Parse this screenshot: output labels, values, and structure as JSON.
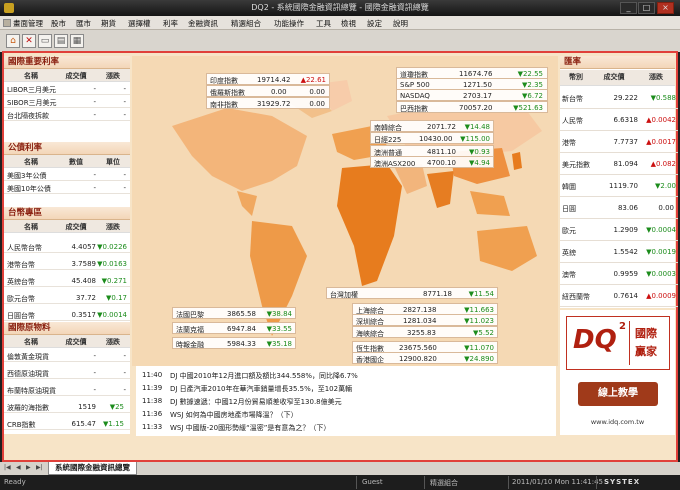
{
  "window": {
    "title": "DQ2 - 系統國際金融資訊總覽 - 國際金融資訊總覽",
    "min": "_",
    "max": "□",
    "close": "×"
  },
  "menu": [
    "畫面管理",
    "股市",
    "匯市",
    "期貨",
    "選擇權",
    "利率",
    "金融資訊",
    "精選組合",
    "功能操作",
    "工具",
    "檢視",
    "設定",
    "說明"
  ],
  "colors": {
    "up": "#1c8c1c",
    "down": "#cc1010",
    "accent": "#e0403a",
    "header": "#8a2010"
  },
  "left": {
    "sec1": {
      "title": "國際重要利率",
      "cols": [
        "名稱",
        "成交價",
        "漲跌"
      ],
      "rows": [
        {
          "name": "LIBOR三月美元",
          "price": "-",
          "chg": "-"
        },
        {
          "name": "SIBOR三月美元",
          "price": "-",
          "chg": "-"
        },
        {
          "name": "台北隔夜拆款",
          "price": "-",
          "chg": "-"
        }
      ]
    },
    "sec2": {
      "title": "公債利率",
      "cols": [
        "名稱",
        "數值",
        "單位"
      ],
      "rows": [
        {
          "name": "美國3年公債",
          "price": "-",
          "chg": "-"
        },
        {
          "name": "美國10年公債",
          "price": "-",
          "chg": "-"
        }
      ]
    },
    "sec3": {
      "title": "台幣專區",
      "cols": [
        "名稱",
        "成交價",
        "漲跌"
      ],
      "rows": [
        {
          "name": "人民幣台幣",
          "price": "4.4057",
          "chg": "▼0.0226",
          "dir": "up"
        },
        {
          "name": "港幣台幣",
          "price": "3.7589",
          "chg": "▼0.0163",
          "dir": "up"
        },
        {
          "name": "英鎊台幣",
          "price": "45.408",
          "chg": "▼0.271",
          "dir": "up"
        },
        {
          "name": "歐元台幣",
          "price": "37.72",
          "chg": "▼0.17",
          "dir": "up"
        },
        {
          "name": "日圓台幣",
          "price": "0.3517",
          "chg": "▼0.0014",
          "dir": "up"
        }
      ]
    },
    "sec4": {
      "title": "國際原物料",
      "cols": [
        "名稱",
        "成交價",
        "漲跌"
      ],
      "rows": [
        {
          "name": "倫敦黃金現貨",
          "price": "-",
          "chg": "-"
        },
        {
          "name": "西德原油現貨",
          "price": "-",
          "chg": "-"
        },
        {
          "name": "布蘭特原油現貨",
          "price": "-",
          "chg": "-"
        },
        {
          "name": "波羅的海指數",
          "price": "1519",
          "chg": "▼25",
          "dir": "up"
        },
        {
          "name": "CRB指數",
          "price": "615.47",
          "chg": "▼1.15",
          "dir": "up"
        }
      ]
    }
  },
  "right": {
    "title": "匯率",
    "cols": [
      "幣別",
      "成交價",
      "漲跌"
    ],
    "rows": [
      {
        "name": "新台幣",
        "price": "29.222",
        "chg": "▼0.588",
        "dir": "up"
      },
      {
        "name": "人民幣",
        "price": "6.6318",
        "chg": "▲0.0042",
        "dir": "down"
      },
      {
        "name": "港幣",
        "price": "7.7737",
        "chg": "▲0.0017",
        "dir": "down"
      },
      {
        "name": "美元指數",
        "price": "81.094",
        "chg": "▲0.082",
        "dir": "down"
      },
      {
        "name": "韓圜",
        "price": "1119.70",
        "chg": "▼2.00",
        "dir": "up"
      },
      {
        "name": "日圓",
        "price": "83.06",
        "chg": "0.00",
        "dir": "flat"
      },
      {
        "name": "歐元",
        "price": "1.2909",
        "chg": "▼0.0004",
        "dir": "up"
      },
      {
        "name": "英鎊",
        "price": "1.5542",
        "chg": "▼0.0019",
        "dir": "up"
      },
      {
        "name": "澳幣",
        "price": "0.9959",
        "chg": "▼0.0003",
        "dir": "up"
      },
      {
        "name": "紐西蘭幣",
        "price": "0.7614",
        "chg": "▲0.0009",
        "dir": "down"
      }
    ]
  },
  "quotes": {
    "india": {
      "name": "印度指數",
      "price": "19714.42",
      "chg": "▲22.61",
      "dir": "down"
    },
    "russia": {
      "name": "俄羅斯指數",
      "price": "0.00",
      "chg": "0.00",
      "dir": "flat"
    },
    "safrica": {
      "name": "南非指數",
      "price": "31929.72",
      "chg": "0.00",
      "dir": "flat"
    },
    "dow": {
      "name": "道瓊指數",
      "price": "11674.76",
      "chg": "▼22.55",
      "dir": "up"
    },
    "sp": {
      "name": "S&P 500",
      "price": "1271.50",
      "chg": "▼2.35",
      "dir": "up"
    },
    "nasdaq": {
      "name": "NASDAQ",
      "price": "2703.17",
      "chg": "▼6.72",
      "dir": "up"
    },
    "brazil": {
      "name": "巴西指數",
      "price": "70057.20",
      "chg": "▼521.63",
      "dir": "up"
    },
    "korea": {
      "name": "南韓綜合",
      "price": "2071.72",
      "chg": "▼14.48",
      "dir": "up"
    },
    "nikkei": {
      "name": "日經225",
      "price": "10430.00",
      "chg": "▼115.00",
      "dir": "up"
    },
    "aus": {
      "name": "澳洲普通",
      "price": "4811.10",
      "chg": "▼0.93",
      "dir": "up"
    },
    "asx": {
      "name": "澳洲ASX200",
      "price": "4700.10",
      "chg": "▼4.94",
      "dir": "up"
    },
    "france": {
      "name": "法國巴黎",
      "price": "3865.58",
      "chg": "▼38.84",
      "dir": "up"
    },
    "germany": {
      "name": "法蘭克福",
      "price": "6947.84",
      "chg": "▼33.55",
      "dir": "up"
    },
    "ftse": {
      "name": "時報金融",
      "price": "5984.33",
      "chg": "▼35.18",
      "dir": "up"
    },
    "twse": {
      "name": "台灣加權",
      "price": "8771.18",
      "chg": "▼11.54",
      "dir": "up"
    },
    "shanghai": {
      "name": "上海綜合",
      "price": "2827.138",
      "chg": "▼11.663",
      "dir": "up"
    },
    "shenzhen": {
      "name": "深圳綜合",
      "price": "1281.034",
      "chg": "▼11.023",
      "dir": "up"
    },
    "sg": {
      "name": "海峽綜合",
      "price": "3255.83",
      "chg": "▼5.52",
      "dir": "up"
    },
    "hsi": {
      "name": "恆生指數",
      "price": "23675.560",
      "chg": "▼11.070",
      "dir": "up"
    },
    "hscei": {
      "name": "香港國企",
      "price": "12900.820",
      "chg": "▼24.890",
      "dir": "up"
    }
  },
  "news": [
    {
      "time": "11:40",
      "text": "DJ 中國2010年12月進口額及額比344.558%，同比降6.7%"
    },
    {
      "time": "11:39",
      "text": "DJ 日產汽車2010年在華汽車銷量增長35.5%，至102萬輛"
    },
    {
      "time": "11:38",
      "text": "DJ 數據速遞：中國12月份貿易順差收窄至130.8億美元"
    },
    {
      "time": "11:36",
      "text": "WSJ 如何為中國房地產市場降溫？（下）"
    },
    {
      "time": "11:33",
      "text": "WSJ 中國版-20國形勢緩“溫密”是有意為之？（下）"
    }
  ],
  "promo": {
    "logo_text": "DQ",
    "logo_sup": "2",
    "logo_side1": "國際",
    "logo_side2": "贏家",
    "button": "線上教學",
    "site": "www.idq.com.tw"
  },
  "tab": {
    "label": "系統國際金融資訊總覽"
  },
  "status": {
    "ready": "Ready",
    "guest": "Guest",
    "combo": "精選組合",
    "time": "2011/01/10 Mon 11:41:45",
    "brand": "SYSTEX"
  }
}
